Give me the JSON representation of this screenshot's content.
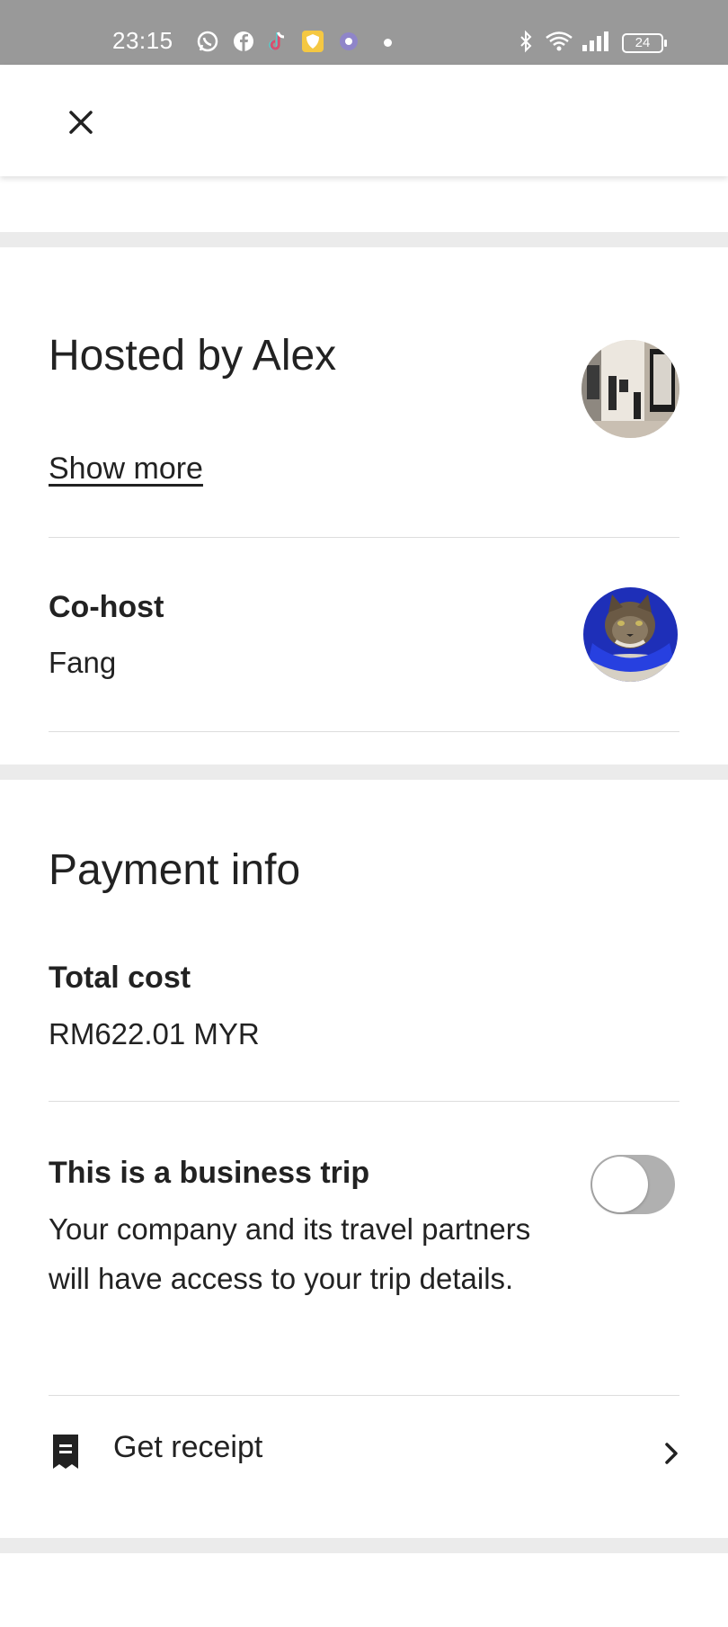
{
  "status_bar": {
    "time": "23:15",
    "battery": "24",
    "app_icons": [
      "whatsapp-icon",
      "facebook-icon",
      "tiktok-icon",
      "shield-app-icon",
      "gear-app-icon"
    ],
    "system_icons": [
      "bluetooth-icon",
      "wifi-icon",
      "signal-icon",
      "battery-icon"
    ]
  },
  "header": {
    "close_icon": "close-icon"
  },
  "host_section": {
    "title": "Hosted by Alex",
    "show_more_label": "Show more",
    "cohost_label": "Co-host",
    "cohost_name": "Fang"
  },
  "payment_section": {
    "title": "Payment info",
    "total_cost_label": "Total cost",
    "total_cost_value": "RM622.01 MYR",
    "business_trip_label": "This is a business trip",
    "business_trip_description": "Your company and its travel partners will have access to your trip details.",
    "business_trip_enabled": false,
    "receipt_label": "Get receipt"
  },
  "colors": {
    "text": "#222222",
    "status_bar": "#999999",
    "divider": "#ebebeb",
    "toggle_off": "#b0b0b0"
  }
}
